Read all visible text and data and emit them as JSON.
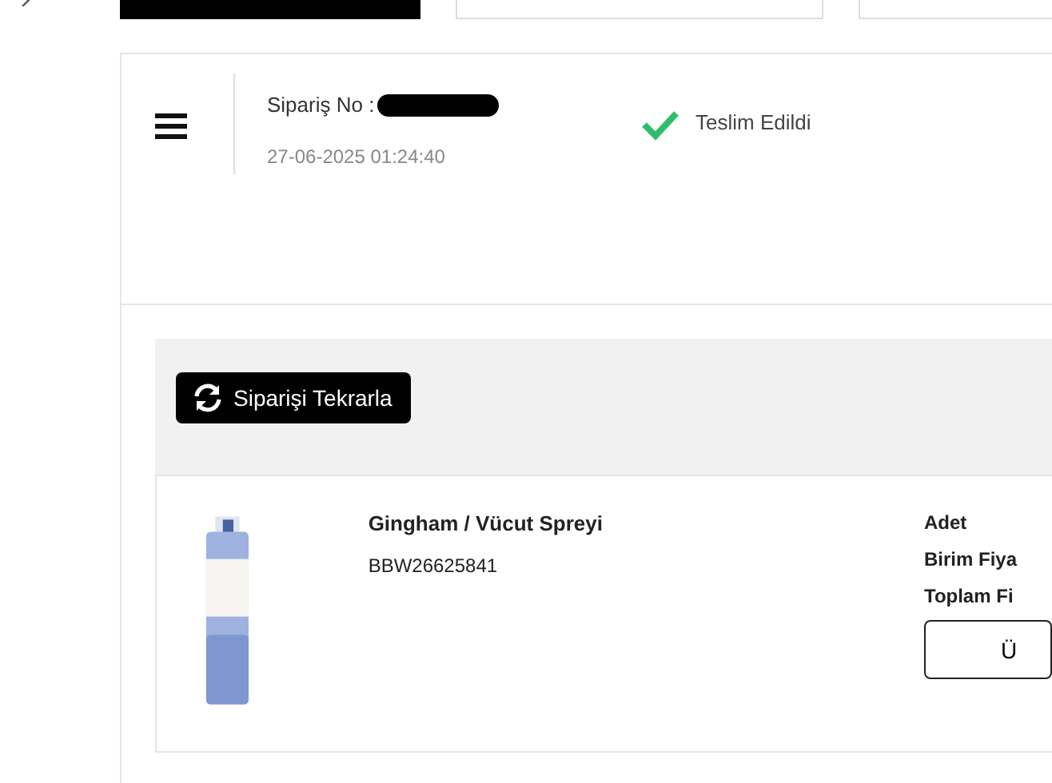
{
  "order": {
    "label": "Sipariş No :",
    "number_redacted": true,
    "date": "27-06-2025 01:24:40",
    "status": {
      "text": "Teslim Edildi",
      "kind": "delivered"
    }
  },
  "reorder_button": "Siparişi Tekrarla",
  "product": {
    "name": "Gingham / Vücut Spreyi",
    "sku": "BBW26625841",
    "details": [
      "Adet",
      "Birim Fiya",
      "Toplam Fi"
    ],
    "button": "Ü"
  }
}
